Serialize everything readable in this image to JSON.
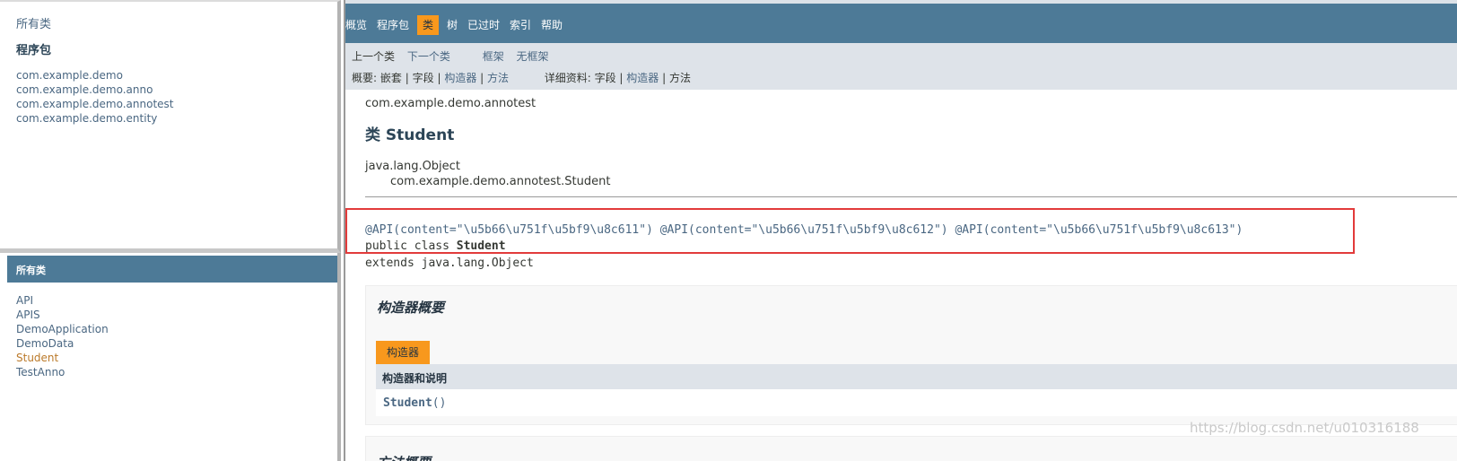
{
  "left_top": {
    "all_classes_link": "所有类",
    "packages_title": "程序包",
    "packages": [
      "com.example.demo",
      "com.example.demo.anno",
      "com.example.demo.annotest",
      "com.example.demo.entity"
    ]
  },
  "left_bottom": {
    "title": "所有类",
    "classes": [
      "API",
      "APIS",
      "DemoApplication",
      "DemoData",
      "Student",
      "TestAnno"
    ]
  },
  "topnav": {
    "items": [
      "概览",
      "程序包",
      "类",
      "树",
      "已过时",
      "索引",
      "帮助"
    ],
    "active": "类"
  },
  "subnav": {
    "prev_class": "上一个类",
    "next_class": "下一个类",
    "frames": "框架",
    "no_frames": "无框架",
    "summary_label": "概要:",
    "summary_nested": "嵌套",
    "summary_field": "字段",
    "summary_constructor": "构造器",
    "summary_method": "方法",
    "detail_label": "详细资料:",
    "detail_field": "字段",
    "detail_constructor": "构造器",
    "detail_method": "方法",
    "sep": "|"
  },
  "class_page": {
    "package": "com.example.demo.annotest",
    "title": "类 Student",
    "inherit_parent": "java.lang.Object",
    "inherit_child": "com.example.demo.annotest.Student",
    "annotations": "@API(content=\"\\u5b66\\u751f\\u5bf9\\u8c611\") @API(content=\"\\u5b66\\u751f\\u5bf9\\u8c612\") @API(content=\"\\u5b66\\u751f\\u5bf9\\u8c613\")",
    "decl_prefix": "public class ",
    "decl_name": "Student",
    "extends_line": "extends java.lang.Object"
  },
  "constructor_summary": {
    "heading": "构造器概要",
    "tab": "构造器",
    "column_header": "构造器和说明",
    "ctor_name": "Student",
    "ctor_parens": "()"
  },
  "method_summary": {
    "heading": "方法概要"
  },
  "watermark": "https://blog.csdn.net/u010316188",
  "colors": {
    "nav_bar": "#4D7A97",
    "active_tab": "#F8981D",
    "subnav": "#dee3e9",
    "link": "#4A6782",
    "highlight_box": "#e23b3b"
  }
}
